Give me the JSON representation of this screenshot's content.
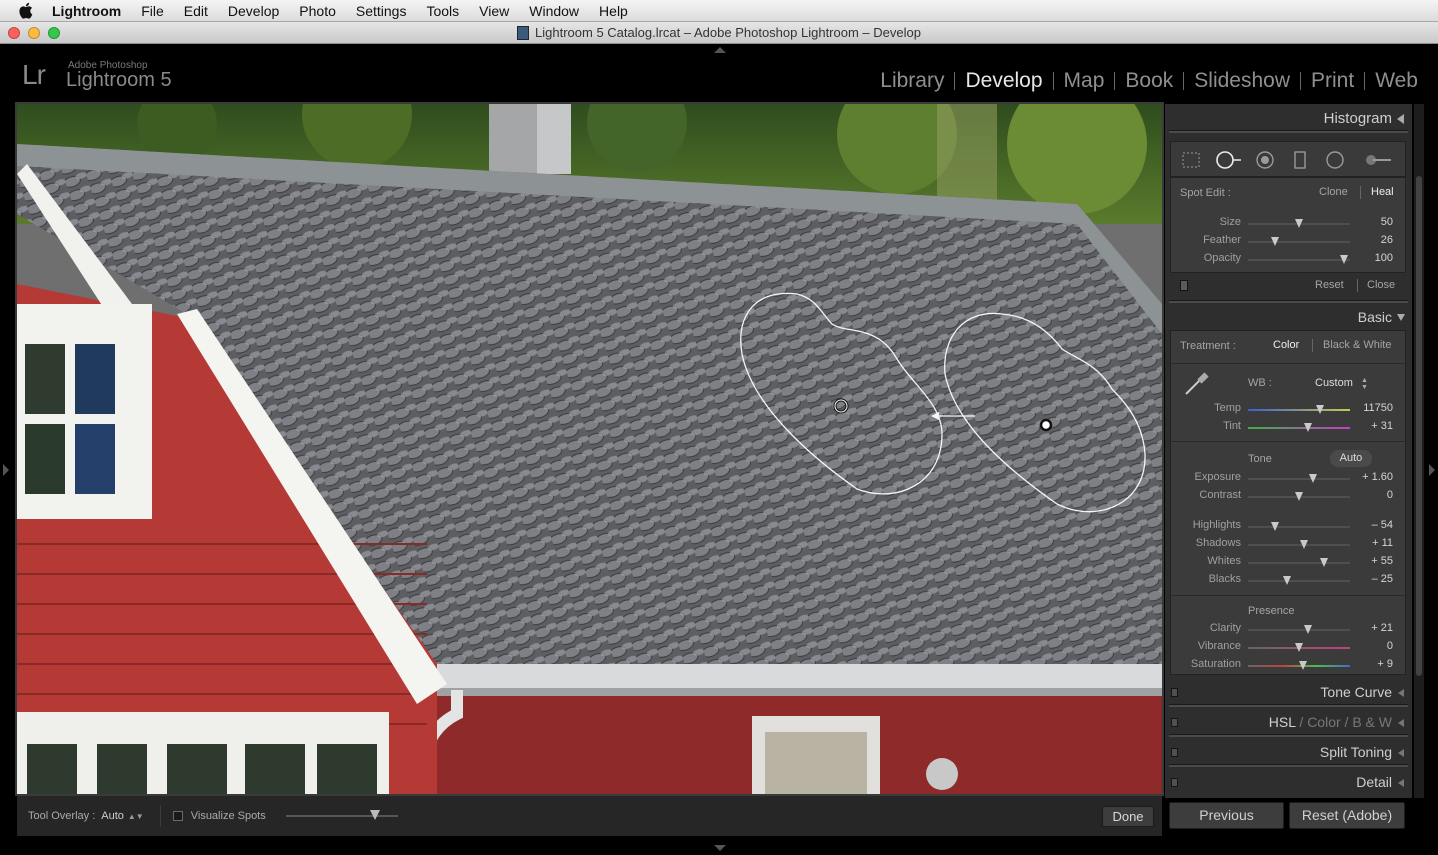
{
  "menubar": {
    "app": "Lightroom",
    "items": [
      "File",
      "Edit",
      "Develop",
      "Photo",
      "Settings",
      "Tools",
      "View",
      "Window",
      "Help"
    ]
  },
  "window": {
    "title": "Lightroom 5 Catalog.lrcat – Adobe Photoshop Lightroom – Develop"
  },
  "header": {
    "logo_mark": "Lr",
    "logo_subtitle": "Adobe Photoshop",
    "logo_name": "Lightroom 5",
    "modules": [
      "Library",
      "Develop",
      "Map",
      "Book",
      "Slideshow",
      "Print",
      "Web"
    ],
    "active_module": "Develop"
  },
  "toolbar": {
    "overlay_label": "Tool Overlay :",
    "overlay_value": "Auto",
    "visualize_label": "Visualize Spots",
    "visualize_checked": false,
    "visualize_threshold": 0.78,
    "done_label": "Done"
  },
  "panel": {
    "histogram_title": "Histogram",
    "tool_icons": [
      "crop-overlay-icon",
      "spot-removal-icon",
      "red-eye-icon",
      "graduated-filter-icon",
      "radial-filter-icon",
      "adjustment-brush-icon"
    ],
    "spot": {
      "label": "Spot Edit :",
      "mode_clone": "Clone",
      "mode_heal": "Heal",
      "active_mode": "Heal",
      "sliders": [
        {
          "label": "Size",
          "value": "50",
          "pos": 0.5
        },
        {
          "label": "Feather",
          "value": "26",
          "pos": 0.26
        },
        {
          "label": "Opacity",
          "value": "100",
          "pos": 0.95
        }
      ],
      "reset_label": "Reset",
      "close_label": "Close"
    },
    "basic": {
      "title": "Basic",
      "treatment_label": "Treatment :",
      "treatment_color": "Color",
      "treatment_bw": "Black & White",
      "wb_label": "WB :",
      "wb_value": "Custom",
      "temp": {
        "label": "Temp",
        "value": "11750",
        "pos": 0.7
      },
      "tint": {
        "label": "Tint",
        "value": "+ 31",
        "pos": 0.58
      },
      "tone_label": "Tone",
      "auto_label": "Auto",
      "tone_sliders": [
        {
          "label": "Exposure",
          "value": "+ 1.60",
          "pos": 0.63
        },
        {
          "label": "Contrast",
          "value": "0",
          "pos": 0.5
        }
      ],
      "tone_sliders2": [
        {
          "label": "Highlights",
          "value": "– 54",
          "pos": 0.26
        },
        {
          "label": "Shadows",
          "value": "+ 11",
          "pos": 0.55
        },
        {
          "label": "Whites",
          "value": "+ 55",
          "pos": 0.74
        },
        {
          "label": "Blacks",
          "value": "– 25",
          "pos": 0.38
        }
      ],
      "presence_label": "Presence",
      "presence_sliders": [
        {
          "label": "Clarity",
          "value": "+ 21",
          "pos": 0.58
        },
        {
          "label": "Vibrance",
          "value": "0",
          "pos": 0.5
        },
        {
          "label": "Saturation",
          "value": "+ 9",
          "pos": 0.53
        }
      ]
    },
    "sections": [
      "Tone Curve",
      "Split Toning",
      "Detail"
    ],
    "hsl": {
      "a": "HSL",
      "b": "Color",
      "c": "B & W",
      "sep": "/"
    },
    "previous_label": "Previous",
    "reset_adobe_label": "Reset (Adobe)"
  },
  "colors": {
    "active_module": "#e8e8e8",
    "panel_bg": "#2e2e2e",
    "roof_gray": "#6f6f6f",
    "wall_red": "#b53a36"
  }
}
